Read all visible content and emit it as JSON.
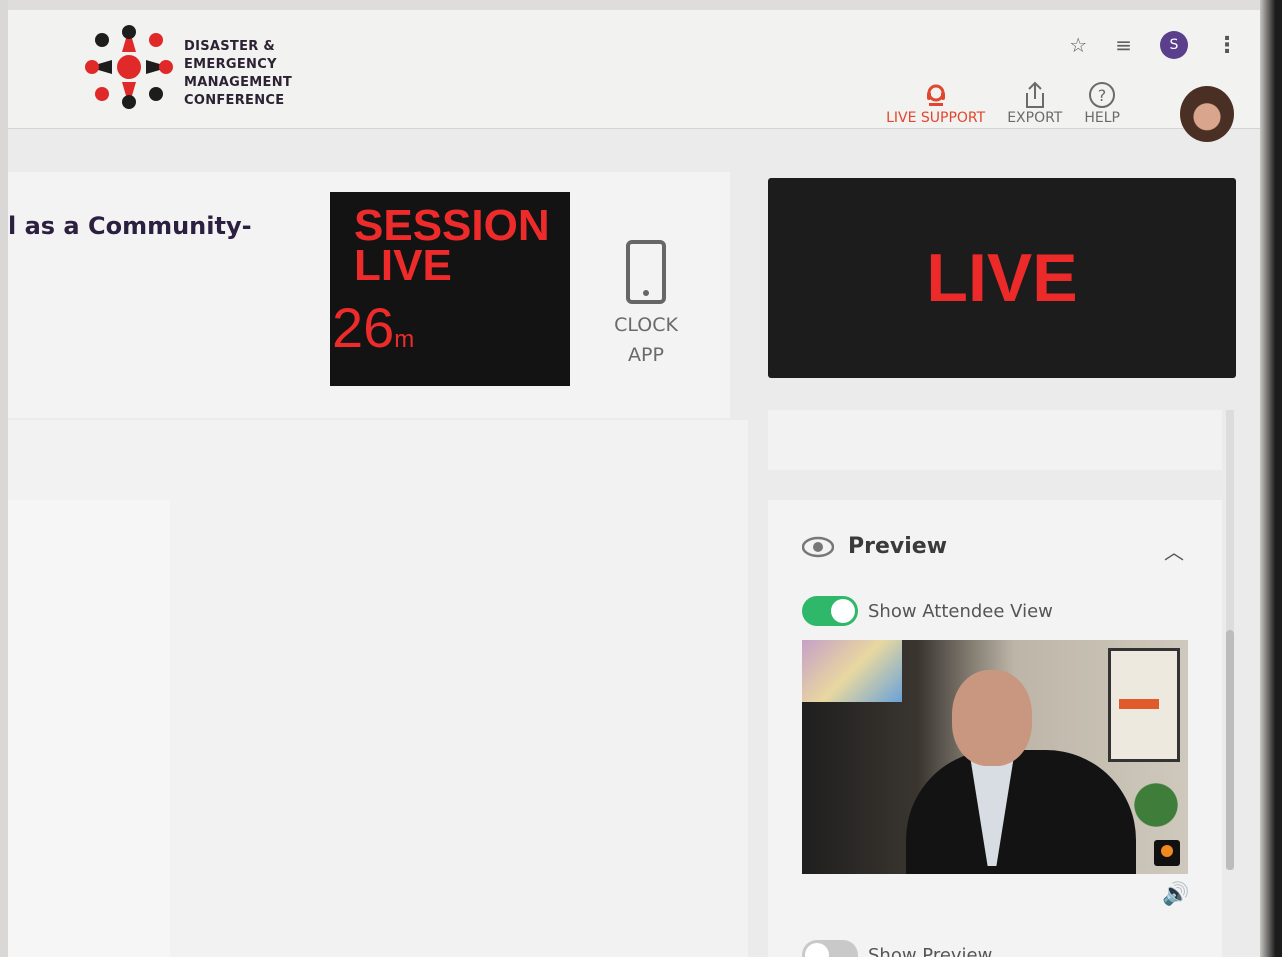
{
  "brand": {
    "lines": [
      "DISASTER &",
      "EMERGENCY",
      "MANAGEMENT",
      "CONFERENCE"
    ],
    "colors": {
      "red": "#e02a2a",
      "dark": "#2c2233"
    }
  },
  "browser": {
    "profile_initial": "S",
    "icons": [
      "star-icon",
      "media-queue-icon",
      "kebab-menu-icon"
    ]
  },
  "header_actions": {
    "live_support": "LIVE SUPPORT",
    "export": "EXPORT",
    "help": "HELP",
    "accent": "#e1472f"
  },
  "session": {
    "title_fragment": "l as a Community-",
    "status": "SESSION LIVE",
    "elapsed_value": "26",
    "elapsed_unit": "m",
    "clock_app_line1": "CLOCK",
    "clock_app_line2": "APP"
  },
  "live_banner": {
    "text": "LIVE",
    "color": "#ec2a2a"
  },
  "preview": {
    "title": "Preview",
    "show_attendee_view": "Show Attendee View",
    "show_attendee_view_on": true,
    "show_preview": "Show Preview",
    "show_preview_on": false,
    "toggle_on_color": "#2fb86a"
  }
}
